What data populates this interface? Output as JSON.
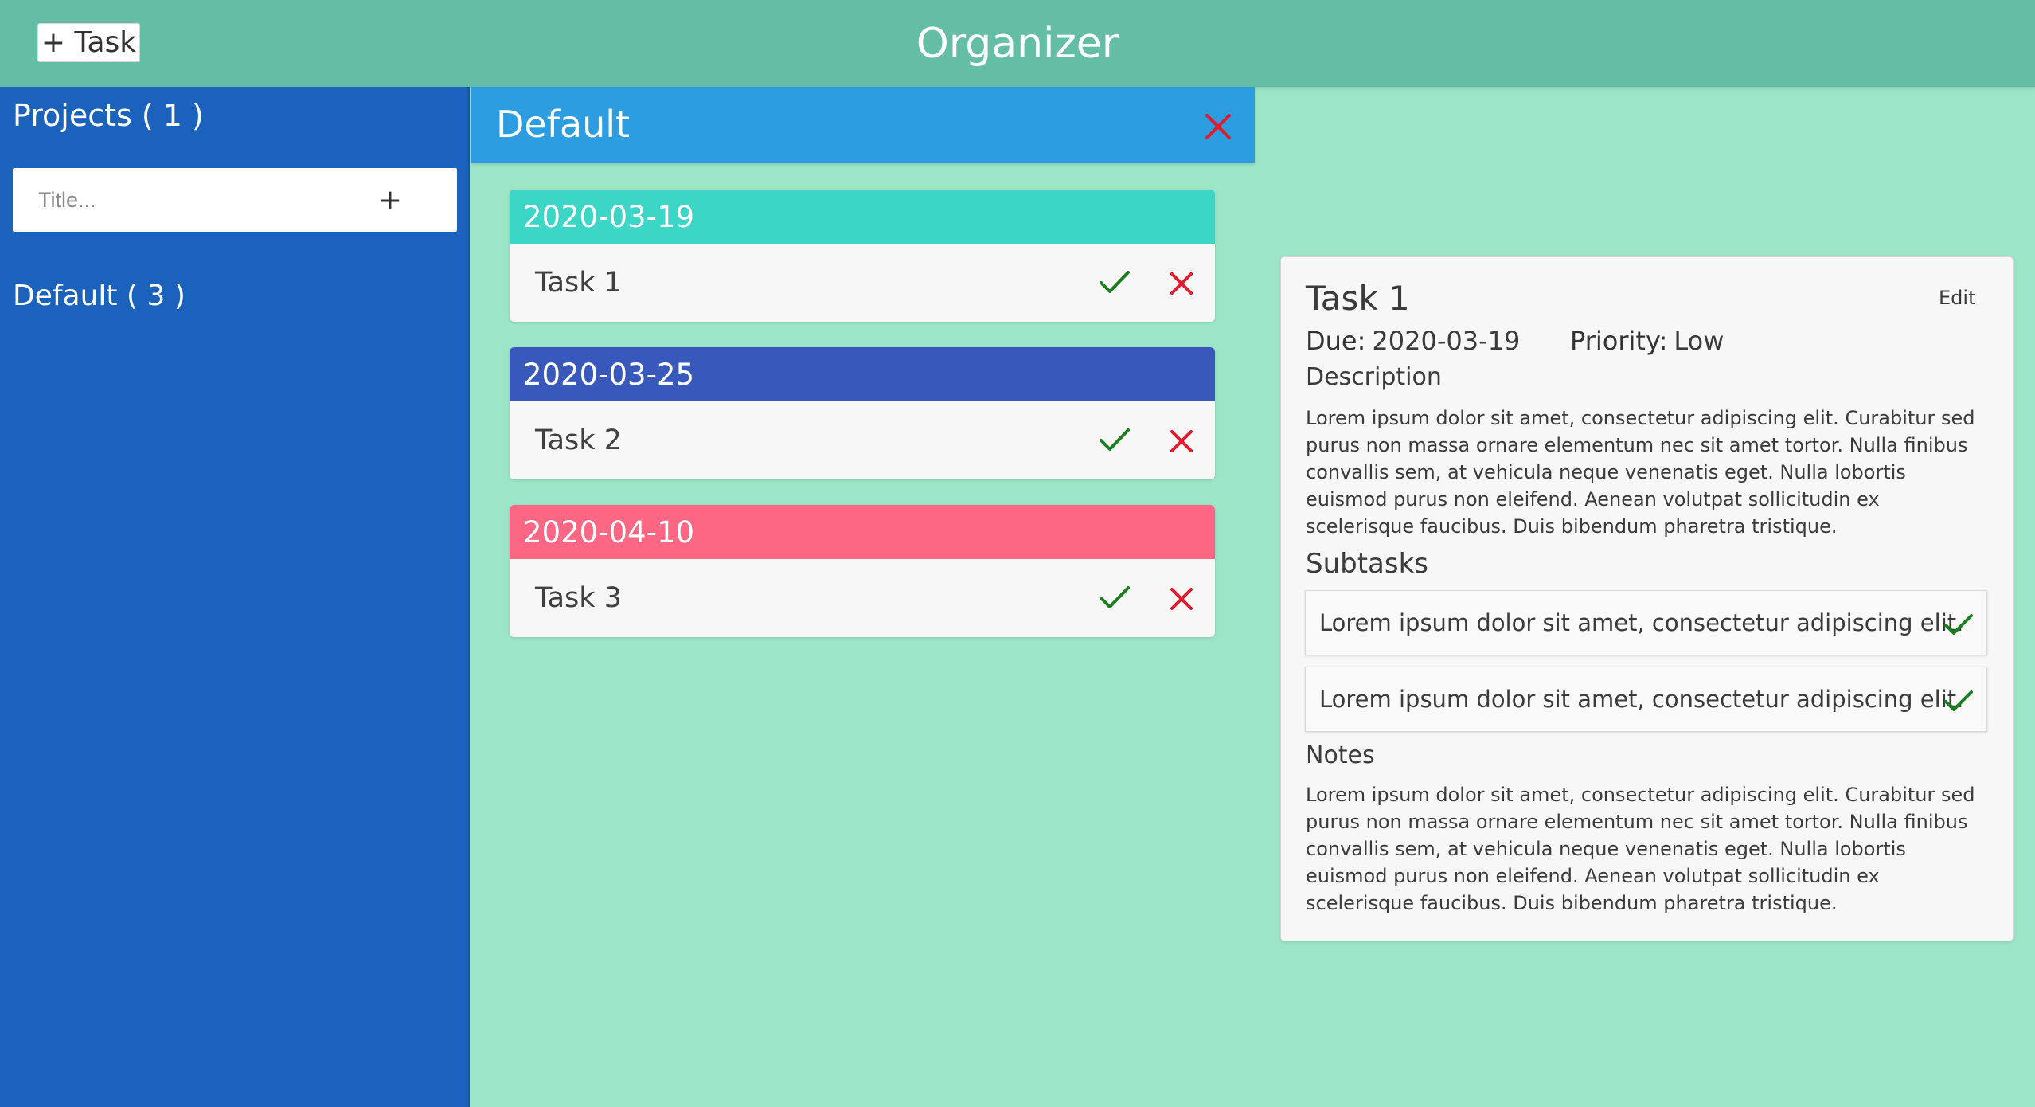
{
  "header": {
    "add_task_label": "+ Task",
    "title": "Organizer"
  },
  "sidebar": {
    "projects_heading": "Projects ( 1 )",
    "new_project_placeholder": "Title...",
    "add_project_label": "+",
    "projects": [
      {
        "label": "Default ( 3 )"
      }
    ]
  },
  "project": {
    "name": "Default"
  },
  "tasks": [
    {
      "date": "2020-03-19",
      "title": "Task 1",
      "color": "#3cd6c6"
    },
    {
      "date": "2020-03-25",
      "title": "Task 2",
      "color": "#3859bb"
    },
    {
      "date": "2020-04-10",
      "title": "Task 3",
      "color": "#fd6784"
    }
  ],
  "detail": {
    "title": "Task 1",
    "edit_label": "Edit",
    "due_label": "Due:",
    "due_value": "2020-03-19",
    "priority_label": "Priority:",
    "priority_value": "Low",
    "description_heading": "Description",
    "description": "Lorem ipsum dolor sit amet, consectetur adipiscing elit. Curabitur sed purus non massa ornare elementum nec sit amet tortor. Nulla finibus convallis sem, at vehicula neque venenatis eget. Nulla lobortis euismod purus non eleifend. Aenean volutpat sollicitudin ex scelerisque faucibus. Duis bibendum pharetra tristique.",
    "subtasks_heading": "Subtasks",
    "subtasks": [
      {
        "text": "Lorem ipsum dolor sit amet, consectetur adipiscing elit."
      },
      {
        "text": "Lorem ipsum dolor sit amet, consectetur adipiscing elit."
      }
    ],
    "notes_heading": "Notes",
    "notes": "Lorem ipsum dolor sit amet, consectetur adipiscing elit. Curabitur sed purus non massa ornare elementum nec sit amet tortor. Nulla finibus convallis sem, at vehicula neque venenatis eget. Nulla lobortis euismod purus non eleifend. Aenean volutpat sollicitudin ex scelerisque faucibus. Duis bibendum pharetra tristique."
  },
  "colors": {
    "header": "#64bea5",
    "sidebar": "#1a62bb",
    "project_header": "#2b9de0",
    "background": "#9ce5c7",
    "check": "#1e7d20",
    "delete": "#e01b2b"
  },
  "icons": {
    "check": "check-icon",
    "close": "close-icon"
  }
}
